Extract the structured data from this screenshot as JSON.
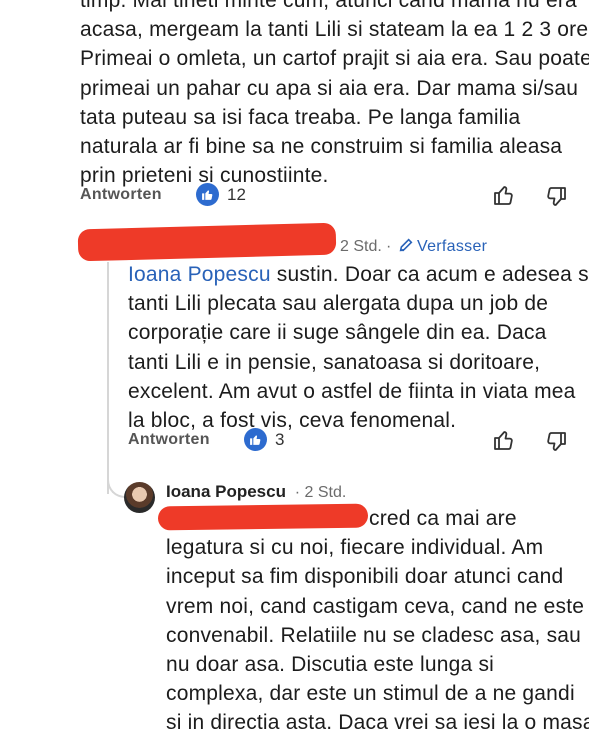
{
  "comment1": {
    "lines": [
      "timp. Mai tineti minte cum, atunci cand mama nu era",
      "acasa, mergeam la tanti Lili si stateam la ea 1 2 3 ore?",
      "Primeai o omleta, un cartof prajit si aia era. Sau poate",
      "primeai un pahar cu apa si aia era. Dar mama si/sau",
      "tata puteau sa isi faca treaba. Pe langa familia",
      "naturala ar fi bine sa ne construim si familia aleasa",
      "prin prieteni si cunostiinte."
    ],
    "reply_label": "Antworten",
    "like_count": "12"
  },
  "reply1": {
    "time": "2 Std.",
    "author_badge": "Verfasser",
    "mention": "Ioana Popescu",
    "first_line_rest": " sustin. Doar ca acum e adesea si",
    "lines": [
      "tanti Lili plecata sau alergata dupa un job de",
      "corporație care ii suge sângele din ea. Daca",
      "tanti Lili e in pensie, sanatoasa si doritoare,",
      "excelent. Am avut o astfel de fiinta in viata mea",
      "la bloc, a fost vis, ceva fenomenal."
    ],
    "reply_label": "Antworten",
    "like_count": "3"
  },
  "reply2": {
    "author": "Ioana Popescu",
    "time": "· 2 Std.",
    "first_line_rest": "cred ca mai are",
    "lines": [
      "legatura si cu noi, fiecare individual. Am",
      "inceput sa fim disponibili doar atunci cand",
      "vrem noi, cand castigam ceva, cand ne este",
      "convenabil. Relatiile nu se cladesc asa, sau",
      "nu doar asa. Discutia este lunga si",
      "complexa, dar este un stimul de a ne gandi",
      "si in directia asta. Daca vrei sa iesi la o masa"
    ]
  },
  "colors": {
    "accent": "#2962b8",
    "like": "#2d6bcf",
    "redaction": "#ee3a28"
  },
  "icons": [
    "like-icon",
    "thumbs-up-icon",
    "thumbs-down-icon",
    "pencil-icon"
  ]
}
